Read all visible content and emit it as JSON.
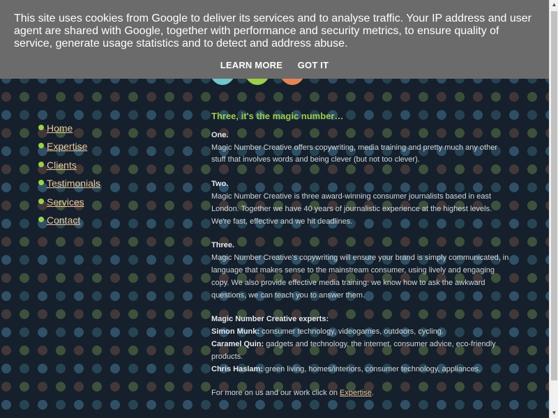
{
  "cookie_banner": {
    "text": "This site uses cookies from Google to deliver its services and to analyse traffic. Your IP address and user agent are shared with Google, together with performance and security metrics, to ensure quality of service, generate usage statistics and to detect and address abuse.",
    "learn_more": "LEARN MORE",
    "got_it": "GOT IT"
  },
  "nav": {
    "items": [
      {
        "label": "Home"
      },
      {
        "label": "Expertise"
      },
      {
        "label": "Clients"
      },
      {
        "label": "Testimonials"
      },
      {
        "label": "Services"
      },
      {
        "label": "Contact"
      }
    ]
  },
  "main": {
    "heading": "Three, it's the magic number…",
    "sections": [
      {
        "title": "One.",
        "body": "Magic Number Creative offers copywriting, media training and pretty much any other stuff that involves words and being clever (but not too clever)."
      },
      {
        "title": "Two.",
        "body": "Magic Number Creative is three award-winning consumer journalists based in east London. Together we have 40 years of journalistic experience at the highest levels. We're fast, effective and we hit deadlines."
      },
      {
        "title": "Three.",
        "body": "Magic Number Creative's copywriting will ensure your brand is simply communicated, in language that makes sense to the mainstream consumer, using lively and engaging copy. We also provide effective media training: we know how to ask the awkward questions, we can teach you to answer them."
      }
    ],
    "experts_title": "Magic Number Creative experts:",
    "experts": [
      {
        "name": "Simon Munk:",
        "topics": "consumer technology, videogames, outdoors, cycling."
      },
      {
        "name": "Caramel Quin:",
        "topics": "gadgets and technology, the internet, consumer advice, eco-friendly products."
      },
      {
        "name": "Chris Haslam:",
        "topics": "green living, homes/interiors, consumer technology, appliances."
      }
    ],
    "footer_text": "For more on us and our work click on ",
    "footer_link": "Expertise",
    "footer_end": "."
  },
  "colors": {
    "accent_green": "#9ccf4a",
    "link": "#f0c89a",
    "background": "#15202c",
    "banner": "#6b6b6b"
  }
}
